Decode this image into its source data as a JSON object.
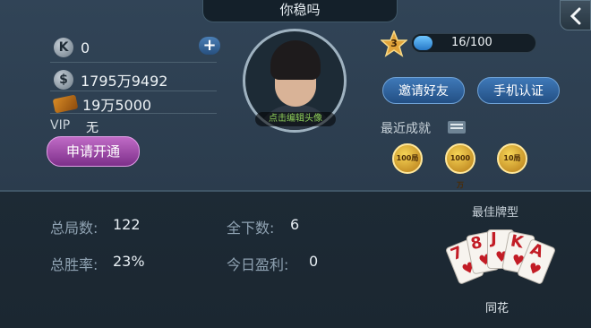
{
  "header": {
    "title": "你稳吗"
  },
  "currency": {
    "k_icon": "K",
    "k_value": "0",
    "coin_icon": "$",
    "coin_value": "1795万9492",
    "ticket_value": "19万5000",
    "plus_label": "+"
  },
  "vip": {
    "label": "VIP",
    "value": "无",
    "apply_label": "申请开通"
  },
  "avatar": {
    "edit_label": "点击编辑头像"
  },
  "level": {
    "value": "3",
    "progress_text": "16/100",
    "progress_fraction": 0.16
  },
  "buttons": {
    "invite": "邀请好友",
    "phone": "手机认证"
  },
  "achievements": {
    "title": "最近成就",
    "badges": [
      "100局",
      "1000万",
      "10局"
    ]
  },
  "stats": {
    "total_games_label": "总局数:",
    "total_games": "122",
    "all_in_label": "全下数:",
    "all_in": "6",
    "win_rate_label": "总胜率:",
    "win_rate": "23%",
    "today_profit_label": "今日盈利:",
    "today_profit": "0"
  },
  "best_hand": {
    "title": "最佳牌型",
    "cards": [
      "7",
      "8",
      "J",
      "K",
      "A"
    ],
    "suit": "♥",
    "name": "同花"
  },
  "colors": {
    "accent_blue": "#2779c7",
    "apply_purple": "#9c45a8",
    "card_red": "#c21c25",
    "badge_gold": "#f6d456"
  }
}
